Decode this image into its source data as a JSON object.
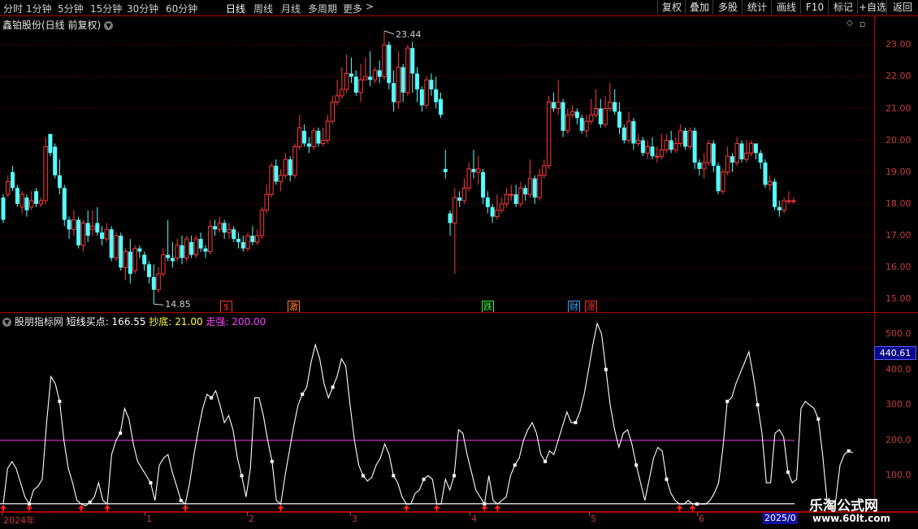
{
  "toolbar": {
    "periods": [
      "分时",
      "1分钟",
      "5分钟",
      "15分钟",
      "30分钟",
      "60分钟",
      "日线",
      "周线",
      "月线",
      "多周期",
      "更多"
    ],
    "active_period": "日线",
    "more_arrow": ">",
    "buttons": [
      "复权",
      "叠加",
      "多股",
      "统计",
      "画线",
      "F10",
      "标记",
      "+自选",
      "返回"
    ]
  },
  "stock": {
    "name_label": "鑫铂股份(日线 前复权)",
    "dropdown_icon": "chevron-down-icon"
  },
  "price_panel": {
    "y_ticks": [
      "23.00",
      "22.00",
      "21.00",
      "20.00",
      "19.00",
      "18.00",
      "17.00",
      "16.00",
      "15.00"
    ],
    "high_label": "23.44",
    "low_label": "14.85",
    "event_markers": [
      {
        "text": "$",
        "color": "#ff3030"
      },
      {
        "text": "激",
        "color": "#ff8030"
      },
      {
        "text": "跌",
        "color": "#30ff30"
      },
      {
        "text": "财",
        "color": "#40a0ff"
      },
      {
        "text": "涨",
        "color": "#ff3030"
      }
    ],
    "colors": {
      "up": "#ff3a3a",
      "down": "#54ffff",
      "grid": "#5a0000"
    }
  },
  "indicator_panel": {
    "name": "股朋指标网",
    "series": [
      {
        "name": "短线买点",
        "value": "166.55",
        "color": "#ffffff"
      },
      {
        "name": "抄底",
        "value": "21.00",
        "color": "#ffff40"
      },
      {
        "name": "走强",
        "value": "200.00",
        "color": "#ff40ff"
      }
    ],
    "y_ticks": [
      "500.0",
      "400.0",
      "300.0",
      "200.0",
      "100.0"
    ],
    "highlight_value": "440.61"
  },
  "time_axis": {
    "labels": [
      "2024年",
      "1",
      "2",
      "3",
      "4",
      "5",
      "6"
    ],
    "end_label": "2025/0"
  },
  "watermark": {
    "line1": "乐淘公式网",
    "line2": "www.60lt.com"
  },
  "chart_data": [
    {
      "type": "candlestick",
      "title": "鑫铂股份(日线 前复权)",
      "ylim": [
        14.6,
        23.9
      ],
      "high_label": 23.44,
      "low_label": 14.85,
      "candles": [
        [
          18.2,
          17.5,
          18.3,
          17.4
        ],
        [
          18.3,
          18.7,
          18.9,
          18.2
        ],
        [
          19.0,
          18.5,
          19.2,
          18.4
        ],
        [
          18.5,
          18.0,
          18.6,
          17.9
        ],
        [
          17.9,
          18.3,
          18.4,
          17.7
        ],
        [
          18.2,
          17.8,
          18.3,
          17.6
        ],
        [
          17.9,
          18.1,
          18.4,
          17.8
        ],
        [
          18.4,
          18.0,
          18.5,
          17.9
        ],
        [
          18.0,
          18.1,
          18.2,
          17.9
        ],
        [
          18.1,
          19.8,
          20.1,
          18.0
        ],
        [
          20.2,
          19.6,
          20.2,
          19.5
        ],
        [
          19.8,
          18.9,
          19.9,
          18.8
        ],
        [
          18.9,
          18.5,
          19.4,
          18.3
        ],
        [
          18.5,
          17.5,
          18.6,
          17.3
        ],
        [
          17.5,
          17.2,
          17.6,
          16.9
        ],
        [
          17.2,
          17.5,
          17.8,
          17.0
        ],
        [
          17.5,
          16.7,
          17.6,
          16.6
        ],
        [
          16.7,
          17.4,
          17.5,
          16.5
        ],
        [
          17.4,
          17.0,
          17.8,
          16.8
        ],
        [
          17.2,
          17.3,
          17.8,
          17.0
        ],
        [
          17.4,
          17.1,
          17.9,
          17.0
        ],
        [
          17.1,
          16.9,
          17.3,
          16.7
        ],
        [
          16.9,
          17.2,
          17.4,
          16.8
        ],
        [
          17.2,
          16.3,
          17.3,
          16.2
        ],
        [
          16.3,
          17.0,
          17.1,
          16.2
        ],
        [
          17.0,
          16.0,
          17.1,
          15.9
        ],
        [
          16.0,
          16.5,
          16.6,
          15.6
        ],
        [
          16.5,
          15.8,
          16.9,
          15.5
        ],
        [
          15.9,
          16.6,
          16.7,
          15.8
        ],
        [
          16.6,
          16.5,
          16.7,
          16.3
        ],
        [
          16.4,
          16.1,
          16.5,
          15.9
        ],
        [
          16.1,
          15.7,
          16.2,
          15.5
        ],
        [
          15.7,
          15.3,
          16.1,
          14.85
        ],
        [
          15.3,
          15.8,
          16.0,
          15.2
        ],
        [
          15.8,
          16.4,
          16.6,
          15.7
        ],
        [
          16.4,
          16.3,
          17.5,
          16.2
        ],
        [
          16.3,
          16.2,
          16.8,
          16.0
        ],
        [
          16.3,
          16.7,
          16.9,
          16.2
        ],
        [
          16.7,
          16.3,
          17.0,
          16.1
        ],
        [
          16.3,
          16.9,
          17.0,
          16.2
        ],
        [
          16.8,
          16.4,
          17.0,
          16.3
        ],
        [
          16.4,
          16.9,
          17.0,
          16.3
        ],
        [
          16.9,
          16.6,
          17.1,
          16.5
        ],
        [
          16.6,
          16.5,
          16.7,
          16.3
        ],
        [
          16.5,
          17.3,
          17.5,
          16.4
        ],
        [
          17.3,
          17.2,
          17.5,
          17.0
        ],
        [
          17.2,
          17.4,
          17.6,
          17.1
        ],
        [
          17.4,
          17.1,
          17.5,
          16.9
        ],
        [
          17.1,
          17.2,
          17.4,
          16.9
        ],
        [
          17.2,
          16.9,
          17.3,
          16.8
        ],
        [
          16.9,
          16.8,
          17.1,
          16.6
        ],
        [
          16.8,
          16.6,
          17.0,
          16.5
        ],
        [
          16.6,
          17.0,
          17.1,
          16.5
        ],
        [
          17.0,
          16.8,
          17.3,
          16.7
        ],
        [
          16.8,
          17.0,
          17.2,
          16.7
        ],
        [
          17.0,
          17.8,
          17.9,
          16.9
        ],
        [
          17.8,
          18.3,
          18.6,
          17.7
        ],
        [
          18.3,
          19.2,
          19.3,
          18.2
        ],
        [
          19.2,
          18.7,
          19.4,
          18.6
        ],
        [
          18.7,
          18.9,
          19.1,
          18.4
        ],
        [
          18.9,
          19.4,
          19.6,
          18.8
        ],
        [
          19.4,
          18.9,
          19.5,
          18.7
        ],
        [
          18.9,
          19.8,
          19.9,
          18.8
        ],
        [
          19.8,
          20.4,
          20.8,
          19.7
        ],
        [
          20.3,
          19.9,
          20.5,
          19.8
        ],
        [
          19.9,
          19.8,
          20.1,
          19.6
        ],
        [
          19.8,
          20.3,
          20.4,
          19.7
        ],
        [
          20.3,
          19.9,
          20.4,
          19.8
        ],
        [
          19.9,
          20.0,
          20.4,
          19.8
        ],
        [
          20.0,
          20.6,
          20.8,
          19.9
        ],
        [
          20.6,
          21.2,
          21.4,
          20.5
        ],
        [
          21.2,
          21.4,
          21.9,
          21.1
        ],
        [
          21.4,
          21.6,
          22.3,
          21.3
        ],
        [
          21.6,
          22.1,
          22.7,
          21.5
        ],
        [
          22.1,
          22.0,
          22.6,
          21.8
        ],
        [
          22.0,
          21.5,
          22.2,
          21.4
        ],
        [
          21.5,
          21.9,
          22.4,
          21.2
        ],
        [
          21.9,
          22.0,
          22.6,
          21.9
        ],
        [
          22.0,
          21.9,
          22.8,
          21.7
        ],
        [
          21.9,
          22.2,
          22.3,
          21.8
        ],
        [
          22.2,
          22.0,
          22.5,
          21.8
        ],
        [
          22.0,
          23.0,
          23.44,
          21.9
        ],
        [
          23.0,
          21.8,
          23.1,
          21.6
        ],
        [
          21.8,
          21.2,
          22.2,
          20.9
        ],
        [
          21.2,
          22.3,
          22.8,
          21.0
        ],
        [
          22.3,
          21.5,
          22.4,
          21.2
        ],
        [
          21.5,
          22.9,
          23.0,
          21.4
        ],
        [
          22.9,
          22.1,
          23.1,
          21.5
        ],
        [
          22.1,
          21.6,
          22.3,
          21.2
        ],
        [
          21.6,
          21.1,
          21.7,
          20.9
        ],
        [
          21.1,
          21.9,
          22.0,
          21.0
        ],
        [
          21.9,
          21.6,
          22.1,
          21.4
        ],
        [
          21.6,
          21.2,
          22.0,
          21.0
        ],
        [
          21.3,
          20.8,
          21.5,
          20.7
        ],
        [
          19.1,
          19.0,
          19.7,
          18.8
        ],
        [
          17.7,
          17.4,
          17.8,
          17.0
        ],
        [
          17.4,
          18.2,
          18.5,
          15.8
        ],
        [
          18.2,
          18.1,
          18.4,
          17.9
        ],
        [
          18.1,
          18.5,
          18.8,
          18.0
        ],
        [
          18.5,
          19.1,
          19.3,
          18.4
        ],
        [
          19.1,
          19.0,
          19.7,
          18.8
        ],
        [
          19.0,
          19.1,
          19.5,
          18.6
        ],
        [
          19.0,
          18.2,
          19.1,
          18.0
        ],
        [
          18.2,
          17.9,
          18.4,
          17.7
        ],
        [
          17.9,
          17.6,
          18.0,
          17.4
        ],
        [
          17.6,
          17.8,
          18.3,
          17.5
        ],
        [
          17.8,
          18.0,
          18.2,
          17.7
        ],
        [
          18.0,
          18.3,
          18.5,
          17.9
        ],
        [
          18.3,
          18.3,
          18.6,
          18.1
        ],
        [
          18.3,
          18.0,
          18.6,
          17.9
        ],
        [
          18.0,
          18.5,
          18.7,
          17.9
        ],
        [
          18.5,
          18.3,
          18.6,
          18.1
        ],
        [
          18.3,
          18.8,
          19.4,
          18.2
        ],
        [
          18.8,
          18.2,
          18.9,
          18.0
        ],
        [
          18.2,
          18.9,
          19.1,
          18.1
        ],
        [
          18.9,
          19.2,
          19.4,
          18.8
        ],
        [
          19.2,
          21.2,
          21.4,
          19.1
        ],
        [
          21.2,
          21.0,
          21.5,
          20.9
        ],
        [
          21.0,
          21.2,
          21.9,
          20.8
        ],
        [
          21.2,
          20.3,
          21.3,
          20.1
        ],
        [
          20.3,
          20.8,
          21.0,
          20.2
        ],
        [
          20.8,
          20.9,
          21.1,
          20.7
        ],
        [
          20.9,
          20.7,
          21.0,
          20.5
        ],
        [
          20.7,
          20.3,
          20.8,
          20.2
        ],
        [
          20.3,
          20.6,
          20.8,
          20.1
        ],
        [
          20.6,
          20.8,
          21.3,
          20.5
        ],
        [
          20.8,
          21.0,
          21.6,
          20.7
        ],
        [
          21.0,
          20.5,
          21.3,
          20.4
        ],
        [
          20.5,
          21.0,
          21.4,
          20.4
        ],
        [
          21.0,
          21.2,
          21.8,
          20.9
        ],
        [
          21.2,
          20.9,
          21.6,
          20.8
        ],
        [
          20.9,
          20.4,
          21.2,
          20.2
        ],
        [
          20.4,
          20.0,
          20.5,
          19.9
        ],
        [
          20.0,
          20.6,
          20.9,
          19.9
        ],
        [
          20.6,
          19.9,
          20.7,
          19.7
        ],
        [
          19.9,
          20.0,
          20.2,
          19.8
        ],
        [
          20.0,
          19.6,
          20.1,
          19.5
        ],
        [
          19.6,
          19.8,
          20.0,
          19.4
        ],
        [
          19.8,
          19.5,
          20.1,
          19.4
        ],
        [
          19.5,
          19.5,
          19.8,
          19.3
        ],
        [
          19.5,
          19.7,
          20.2,
          19.4
        ],
        [
          19.7,
          20.0,
          20.2,
          19.6
        ],
        [
          20.0,
          19.7,
          20.3,
          19.6
        ],
        [
          19.7,
          19.9,
          20.1,
          19.6
        ],
        [
          19.9,
          20.3,
          20.5,
          19.8
        ],
        [
          20.3,
          19.8,
          20.4,
          19.7
        ],
        [
          19.8,
          20.3,
          20.4,
          19.7
        ],
        [
          20.3,
          19.3,
          20.4,
          19.1
        ],
        [
          19.3,
          19.1,
          19.4,
          18.9
        ],
        [
          19.1,
          19.3,
          19.6,
          18.8
        ],
        [
          19.3,
          19.9,
          20.0,
          19.2
        ],
        [
          19.9,
          19.2,
          20.0,
          19.0
        ],
        [
          19.2,
          18.4,
          19.3,
          18.3
        ],
        [
          18.4,
          19.0,
          19.1,
          18.3
        ],
        [
          19.0,
          19.5,
          19.8,
          18.9
        ],
        [
          19.5,
          19.3,
          19.6,
          19.0
        ],
        [
          19.3,
          19.9,
          20.1,
          19.2
        ],
        [
          19.9,
          19.4,
          20.0,
          19.3
        ],
        [
          19.4,
          19.6,
          20.0,
          19.3
        ],
        [
          19.6,
          19.9,
          20.0,
          19.5
        ],
        [
          19.9,
          19.6,
          19.9,
          19.4
        ],
        [
          19.6,
          19.3,
          19.7,
          19.1
        ],
        [
          19.3,
          18.6,
          19.4,
          18.5
        ],
        [
          18.6,
          18.7,
          18.9,
          18.4
        ],
        [
          18.7,
          17.9,
          18.8,
          17.8
        ],
        [
          17.9,
          17.8,
          18.1,
          17.6
        ],
        [
          17.8,
          18.1,
          18.2,
          17.7
        ],
        [
          18.1,
          18.1,
          18.4,
          18.0
        ],
        [
          18.1,
          18.1,
          18.2,
          18.0
        ]
      ]
    },
    {
      "type": "line",
      "title": "股朋指标网",
      "ylim": [
        0,
        560
      ],
      "reference_lines": [
        {
          "name": "走强",
          "value": 200
        },
        {
          "name": "抄底",
          "value": 21
        }
      ],
      "series": [
        {
          "name": "短线买点",
          "values": [
            20,
            120,
            140,
            120,
            80,
            40,
            20,
            60,
            70,
            90,
            250,
            380,
            360,
            310,
            200,
            120,
            80,
            30,
            20,
            15,
            25,
            40,
            80,
            30,
            20,
            160,
            200,
            220,
            290,
            260,
            190,
            140,
            120,
            100,
            80,
            30,
            130,
            150,
            160,
            110,
            70,
            30,
            20,
            80,
            160,
            230,
            290,
            330,
            320,
            340,
            300,
            250,
            270,
            230,
            150,
            100,
            40,
            120,
            320,
            320,
            270,
            200,
            140,
            30,
            20,
            100,
            170,
            240,
            300,
            330,
            350,
            420,
            470,
            430,
            360,
            320,
            350,
            380,
            430,
            410,
            300,
            200,
            130,
            100,
            85,
            95,
            130,
            150,
            190,
            160,
            100,
            80,
            40,
            20,
            20,
            50,
            60,
            90,
            100,
            90,
            20,
            20,
            90,
            60,
            100,
            230,
            220,
            160,
            110,
            60,
            40,
            20,
            100,
            30,
            20,
            30,
            40,
            100,
            130,
            150,
            200,
            230,
            250,
            220,
            160,
            140,
            170,
            160,
            200,
            240,
            280,
            250,
            250,
            280,
            330,
            400,
            470,
            530,
            500,
            400,
            300,
            230,
            180,
            220,
            230,
            190,
            130,
            80,
            30,
            90,
            150,
            180,
            170,
            90,
            50,
            30,
            20,
            20,
            30,
            20,
            20,
            20,
            20,
            30,
            50,
            80,
            180,
            310,
            320,
            360,
            390,
            420,
            450,
            380,
            300,
            220,
            80,
            80,
            220,
            230,
            210,
            110,
            80,
            90,
            290,
            310,
            300,
            290,
            260,
            160,
            30,
            20,
            30,
            130,
            160,
            170,
            165
          ]
        }
      ]
    }
  ]
}
